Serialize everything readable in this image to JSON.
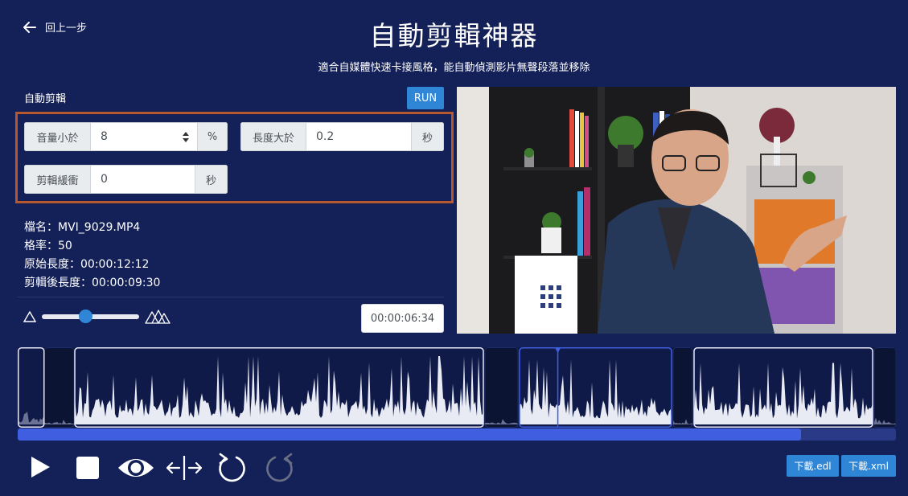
{
  "header": {
    "back_label": "回上一步",
    "title": "自動剪輯神器",
    "subtitle": "適合自媒體快速卡接風格，能自動偵測影片無聲段落並移除"
  },
  "panel": {
    "section_label": "自動剪輯",
    "run_label": "RUN",
    "highlight_color": "#b5582f",
    "volume": {
      "label": "音量小於",
      "value": "8",
      "unit": "%"
    },
    "length": {
      "label": "長度大於",
      "value": "0.2",
      "unit": "秒"
    },
    "buffer": {
      "label": "剪輯緩衝",
      "value": "0",
      "unit": "秒"
    }
  },
  "file_info": {
    "filename": "檔名：MVI_9029.MP4",
    "framerate": "格率：50",
    "original_length": "原始長度：00:00:12:12",
    "edited_length": "剪輯後長度：00:00:09:30"
  },
  "zoom": {
    "level": 0.45
  },
  "current_time": "00:00:06:34",
  "timeline": {
    "progress": 0.892,
    "playhead_fraction": 0.615
  },
  "controls": {
    "icons": [
      "play-icon",
      "stop-icon",
      "eye-icon",
      "split-icon",
      "undo-icon",
      "redo-icon"
    ]
  },
  "downloads": {
    "edl_label": "下載.edl",
    "xml_label": "下載.xml"
  },
  "colors": {
    "background": "#142158",
    "accent": "#2f86d6",
    "progress": "#3f5fe0"
  }
}
